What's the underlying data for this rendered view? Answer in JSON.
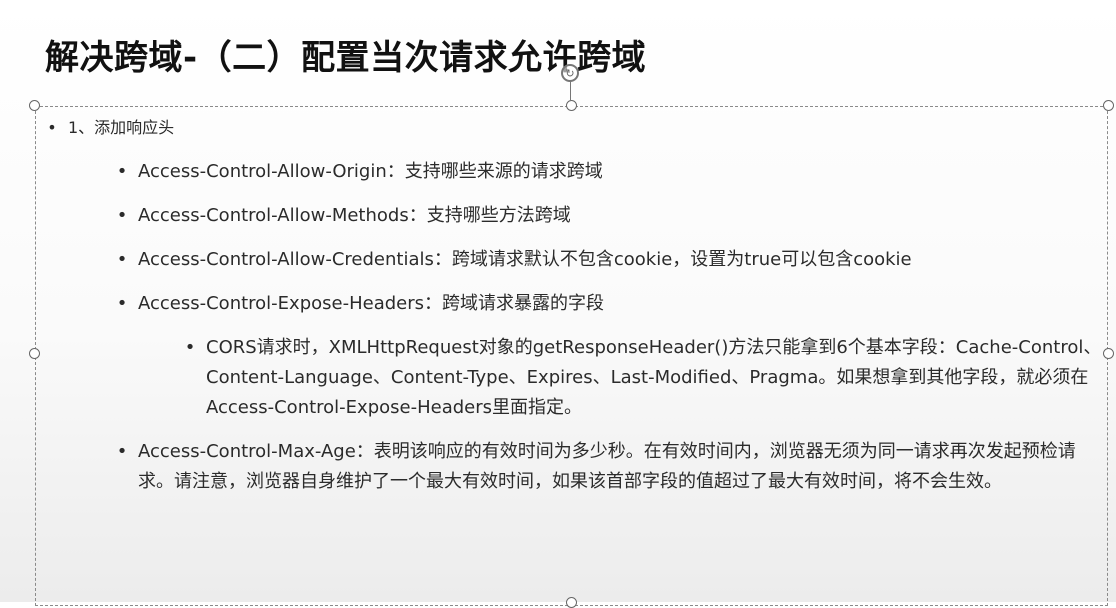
{
  "slide": {
    "title": "解决跨域-（二）配置当次请求允许跨域",
    "bullet_glyph": "•",
    "item1": "1、添加响应头",
    "headers": [
      "Access-Control-Allow-Origin：支持哪些来源的请求跨域",
      "Access-Control-Allow-Methods：支持哪些方法跨域",
      "Access-Control-Allow-Credentials：跨域请求默认不包含cookie，设置为true可以包含cookie",
      "Access-Control-Expose-Headers：跨域请求暴露的字段"
    ],
    "expose_note": "CORS请求时，XMLHttpRequest对象的getResponseHeader()方法只能拿到6个基本字段：Cache-Control、Content-Language、Content-Type、Expires、Last-Modified、Pragma。如果想拿到其他字段，就必须在Access-Control-Expose-Headers里面指定。",
    "max_age": "Access-Control-Max-Age：表明该响应的有效时间为多少秒。在有效时间内，浏览器无须为同一请求再次发起预检请求。请注意，浏览器自身维护了一个最大有效时间，如果该首部字段的值超过了最大有效时间，将不会生效。"
  }
}
